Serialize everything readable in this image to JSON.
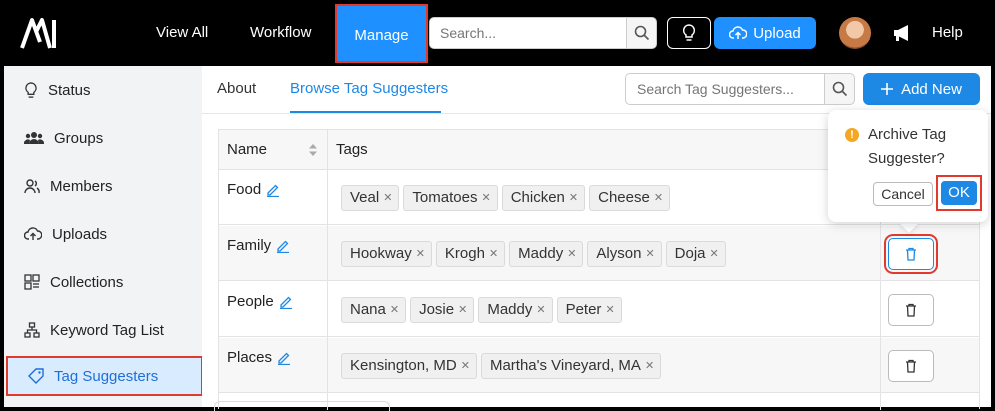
{
  "nav": {
    "view_all": "View All",
    "workflow": "Workflow",
    "manage": "Manage",
    "search_placeholder": "Search...",
    "upload": "Upload",
    "help": "Help"
  },
  "sidebar": {
    "items": [
      {
        "label": "Status",
        "icon": "lightbulb-icon"
      },
      {
        "label": "Groups",
        "icon": "users-icon"
      },
      {
        "label": "Members",
        "icon": "members-icon"
      },
      {
        "label": "Uploads",
        "icon": "cloud-upload-icon"
      },
      {
        "label": "Collections",
        "icon": "collections-icon"
      },
      {
        "label": "Keyword Tag List",
        "icon": "hierarchy-icon"
      },
      {
        "label": "Tag Suggesters",
        "icon": "tag-icon"
      }
    ],
    "active": "Tag Suggesters"
  },
  "main": {
    "tabs": [
      "About",
      "Browse Tag Suggesters"
    ],
    "active_tab": "Browse Tag Suggesters",
    "search_placeholder": "Search Tag Suggesters...",
    "add_new": "Add New"
  },
  "table": {
    "columns": [
      "Name",
      "Tags"
    ],
    "rows": [
      {
        "name": "Food",
        "tags": [
          "Veal",
          "Tomatoes",
          "Chicken",
          "Cheese"
        ]
      },
      {
        "name": "Family",
        "tags": [
          "Hookway",
          "Krogh",
          "Maddy",
          "Alyson",
          "Doja"
        ]
      },
      {
        "name": "People",
        "tags": [
          "Nana",
          "Josie",
          "Maddy",
          "Peter"
        ]
      },
      {
        "name": "Places",
        "tags": [
          "Kensington, MD",
          "Martha's Vineyard, MA"
        ]
      }
    ]
  },
  "popover": {
    "message": "Archive Tag Suggester?",
    "cancel": "Cancel",
    "ok": "OK"
  },
  "colors": {
    "accent": "#1e88e5",
    "highlight": "#e03a2f",
    "warning": "#f5a623"
  }
}
